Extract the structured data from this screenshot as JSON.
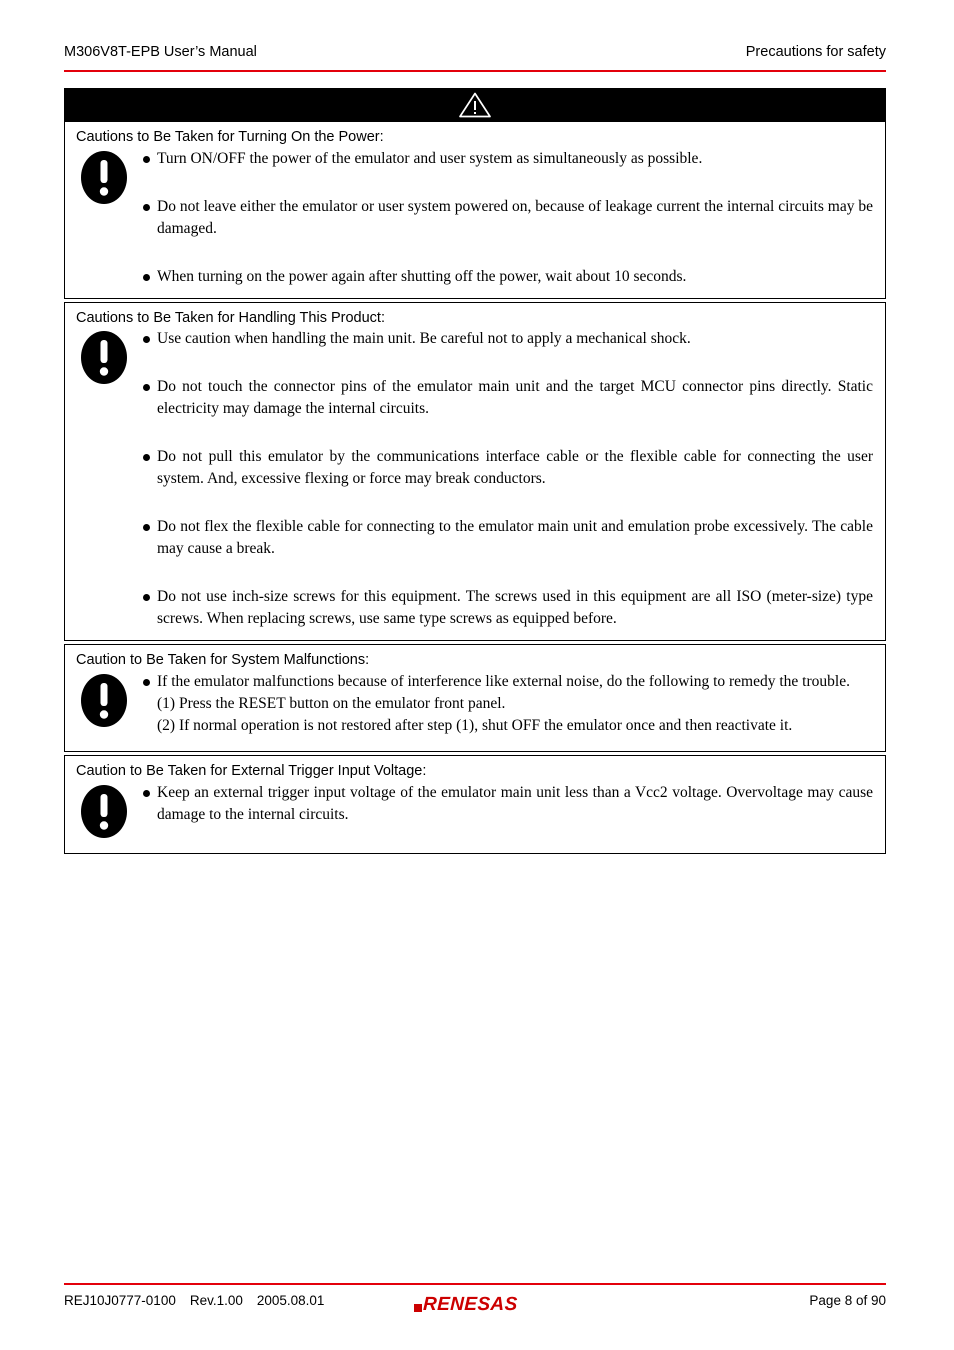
{
  "header": {
    "left": "M306V8T-EPB User’s Manual",
    "right": "Precautions for safety",
    "rule_color": "#e3000b"
  },
  "warning_banner": {
    "icon": "warning-triangle-icon",
    "background": "#000000",
    "icon_color": "#ffffff"
  },
  "sections": [
    {
      "heading": "Cautions to Be Taken for Turning On the Power:",
      "icon": "exclamation-mark-icon",
      "bullets": [
        "Turn ON/OFF the power of the emulator and user system as simultaneously as possible.",
        "Do not leave either the emulator or user system powered on, because of leakage current the internal circuits may be damaged.",
        "When turning on the power again after shutting off the power, wait about 10 seconds."
      ]
    },
    {
      "heading": "Cautions to Be Taken for Handling This Product:",
      "icon": "exclamation-mark-icon",
      "bullets": [
        "Use caution when handling the main unit. Be careful not to apply a mechanical shock.",
        "Do not touch the connector pins of the emulator main unit and the target MCU connector pins directly. Static electricity may damage the internal circuits.",
        "Do not pull this emulator by the communications interface cable or the flexible cable for connecting the user system. And, excessive flexing or force may break conductors.",
        "Do not flex the flexible cable for connecting to the emulator main unit and emulation probe excessively. The cable may cause a break.",
        "Do not use inch-size screws for this equipment. The screws used in this equipment are all ISO (meter-size) type screws. When replacing screws, use same type screws as equipped before."
      ]
    },
    {
      "heading": "Caution to Be Taken for System Malfunctions:",
      "icon": "exclamation-mark-icon",
      "bullets": [
        "If the emulator malfunctions because of interference like external noise, do the following to remedy the trouble."
      ],
      "steps": [
        "(1) Press the RESET button on the emulator front panel.",
        "(2) If normal operation is not restored after step (1), shut OFF the emulator once and then reactivate it."
      ]
    },
    {
      "heading": "Caution to Be Taken for External Trigger Input Voltage:",
      "icon": "exclamation-mark-icon",
      "bullets": [
        "Keep an external trigger input voltage of the emulator main unit less than a Vcc2 voltage. Overvoltage may cause damage to the internal circuits."
      ]
    }
  ],
  "footer": {
    "document_number": "REJ10J0777-0100",
    "revision": "Rev.1.00",
    "date": "2005.08.01",
    "logo_text": "RENESAS",
    "logo_color": "#cc0000",
    "page_label": "Page 8 of 90",
    "rule_color": "#e3000b"
  }
}
